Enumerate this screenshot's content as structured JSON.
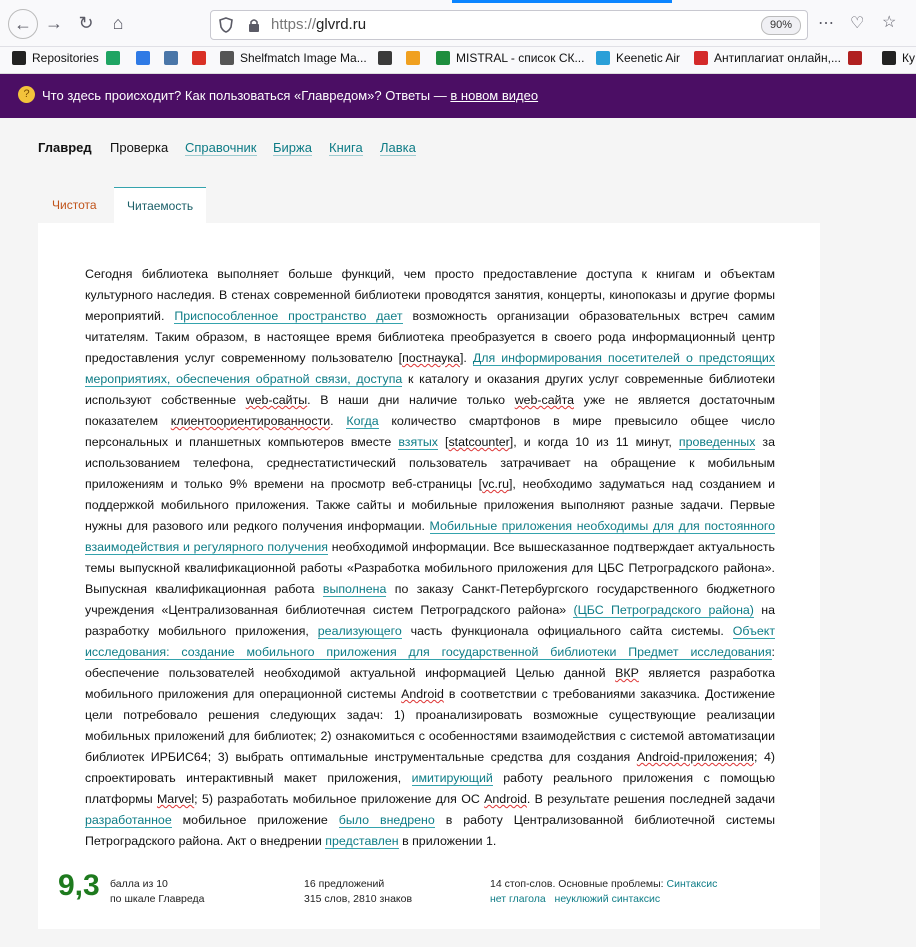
{
  "browser": {
    "url_protocol": "https://",
    "url_host": "glvrd.ru",
    "zoom": "90%"
  },
  "bookmarks": [
    {
      "label": "Repositories",
      "icon": "github-icon",
      "color": "#222222"
    },
    {
      "label": "",
      "icon": "google-drive-icon",
      "color": "#1fa463"
    },
    {
      "label": "",
      "icon": "cloud-icon",
      "color": "#2f7ae5"
    },
    {
      "label": "",
      "icon": "vk-icon",
      "color": "#4a76a8"
    },
    {
      "label": "",
      "icon": "gmail-icon",
      "color": "#d93025"
    },
    {
      "label": "Shelfmatch Image Ma...",
      "icon": "globe-icon",
      "color": "#555555"
    },
    {
      "label": "",
      "icon": "image-icon",
      "color": "#3a3a3a"
    },
    {
      "label": "",
      "icon": "app-icon",
      "color": "#f0a020"
    },
    {
      "label": "MISTRAL - список СК...",
      "icon": "sheets-icon",
      "color": "#1e8e3e"
    },
    {
      "label": "Keenetic Air",
      "icon": "router-icon",
      "color": "#2a9fd8"
    },
    {
      "label": "Антиплагиат онлайн,...",
      "icon": "copyright-icon",
      "color": "#d42a2a"
    },
    {
      "label": "",
      "icon": "wine-icon",
      "color": "#b02020"
    },
    {
      "label": "Ку",
      "icon": "m-icon",
      "color": "#222222"
    }
  ],
  "banner": {
    "text": "Что здесь происходит? Как пользоваться «Главредом»? Ответы —",
    "link": "в новом видео"
  },
  "site_nav": {
    "brand": "Главред",
    "current": "Проверка",
    "links": [
      "Справочник",
      "Биржа",
      "Книга",
      "Лавка"
    ]
  },
  "tabs": {
    "clean": "Чистота",
    "readability": "Читаемость"
  },
  "article": {
    "segments": [
      [
        "t",
        "Сегодня библиотека выполняет больше функций, чем просто предоставление доступа к книгам и объектам культурного наследия. В стенах современной библиотеки проводятся занятия, концерты, кинопоказы и другие формы мероприятий. "
      ],
      [
        "h",
        "Приспособленное пространство дает"
      ],
      [
        "t",
        " возможность организации образовательных встреч самим читателям. Таким образом, в настоящее время библиотека преобразуется в своего рода информационный центр предоставления услуг современному пользователю ["
      ],
      [
        "w",
        "постнаука"
      ],
      [
        "t",
        "]. "
      ],
      [
        "h",
        "Для информирования посетителей о предстоящих мероприятиях, обеспечения обратной связи, доступа"
      ],
      [
        "t",
        " к каталогу и оказания других услуг современные библиотеки используют собственные "
      ],
      [
        "w",
        "web-сайты"
      ],
      [
        "t",
        ". В наши дни наличие только "
      ],
      [
        "w",
        "web-сайта"
      ],
      [
        "t",
        " уже не является достаточным показателем "
      ],
      [
        "w",
        "клиентоориентированности"
      ],
      [
        "t",
        ". "
      ],
      [
        "h",
        "Когда"
      ],
      [
        "t",
        " количество смартфонов в мире превысило общее число персональных и планшетных компьютеров вместе "
      ],
      [
        "h",
        "взятых"
      ],
      [
        "t",
        " ["
      ],
      [
        "w",
        "statcounter"
      ],
      [
        "t",
        "], и когда 10 из 11 минут, "
      ],
      [
        "h",
        "проведенных"
      ],
      [
        "t",
        " за использованием телефона, среднестатистический пользователь затрачивает на обращение к мобильным приложениям и только 9% времени на просмотр веб-страницы ["
      ],
      [
        "w",
        "vc.ru"
      ],
      [
        "t",
        "], необходимо задуматься над созданием и поддержкой мобильного приложения. Также сайты и мобильные приложения выполняют разные задачи. Первые нужны для разового или редкого получения информации. "
      ],
      [
        "h",
        "Мобильные приложения необходимы для для постоянного взаимодействия и регулярного получения"
      ],
      [
        "t",
        " необходимой информации. Все вышесказанное подтверждает актуальность темы выпускной квалификационной работы «Разработка мобильного приложения для ЦБС Петроградского района». Выпускная квалификационная работа "
      ],
      [
        "h",
        "выполнена"
      ],
      [
        "t",
        " по заказу Санкт-Петербургского государственного бюджетного учреждения «Централизованная библиотечная систем Петроградского района» "
      ],
      [
        "h",
        "(ЦБС Петроградского района)"
      ],
      [
        "t",
        " на разработку мобильного приложения, "
      ],
      [
        "h",
        "реализующего"
      ],
      [
        "t",
        " часть функционала официального сайта системы. "
      ],
      [
        "h",
        "Объект исследования: создание мобильного приложения для государственной библиотеки Предмет исследования"
      ],
      [
        "t",
        ": обеспечение пользователей необходимой актуальной информацией Целью данной "
      ],
      [
        "w",
        "ВКР"
      ],
      [
        "t",
        " является разработка мобильного приложения для операционной системы "
      ],
      [
        "w",
        "Android"
      ],
      [
        "t",
        " в соответствии с требованиями заказчика. Достижение цели потребовало решения следующих задач: 1) проанализировать возможные существующие реализации мобильных приложений для библиотек; 2) ознакомиться с особенностями взаимодействия с системой автоматизации библиотек ИРБИС64; 3) выбрать оптимальные инструментальные средства для создания "
      ],
      [
        "w",
        "Android-приложения"
      ],
      [
        "t",
        "; 4) спроектировать интерактивный макет приложения, "
      ],
      [
        "h",
        "имитирующий"
      ],
      [
        "t",
        " работу реального приложения с помощью платформы "
      ],
      [
        "w",
        "Marvel"
      ],
      [
        "t",
        "; 5) разработать мобильное приложение для ОС "
      ],
      [
        "w",
        "Android"
      ],
      [
        "t",
        ". В результате решения последней задачи "
      ],
      [
        "h",
        "разработанное"
      ],
      [
        "t",
        " мобильное приложение "
      ],
      [
        "h",
        "было внедрено"
      ],
      [
        "t",
        " в работу Централизованной библиотечной системы Петроградского района. Акт о внедрении "
      ],
      [
        "h",
        "представлен"
      ],
      [
        "t",
        " в приложении 1."
      ]
    ]
  },
  "result": {
    "score": "9,3",
    "score_line1": "балла из 10",
    "score_line2": "по шкале Главреда",
    "sentences": "16 предложений",
    "words": "315 слов, 2810 знаков",
    "stopwords_prefix": "14 стоп-слов. Основные проблемы:",
    "problems": [
      "Синтаксис",
      "нет глагола",
      "неуклюжий синтаксис"
    ]
  }
}
